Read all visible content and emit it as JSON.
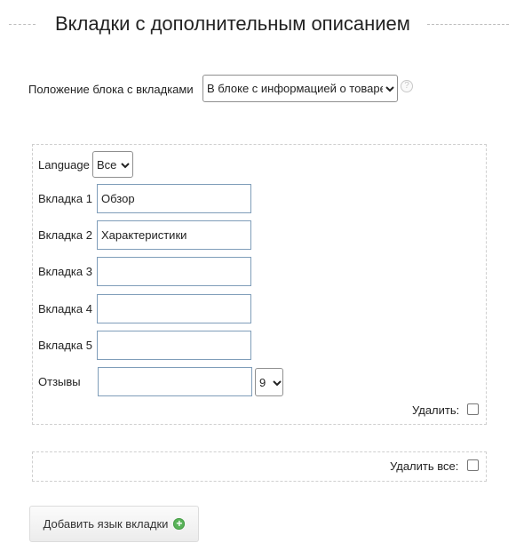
{
  "section": {
    "title": "Вкладки с дополнительным описанием"
  },
  "position": {
    "label": "Положение блока с вкладками",
    "selected": "В блоке с информацией о товаре"
  },
  "tabs_panel": {
    "language_label": "Language",
    "language_selected": "Все",
    "tabs": [
      {
        "label": "Вкладка 1",
        "value": "Обзор"
      },
      {
        "label": "Вкладка 2",
        "value": "Характеристики"
      },
      {
        "label": "Вкладка 3",
        "value": ""
      },
      {
        "label": "Вкладка 4",
        "value": ""
      },
      {
        "label": "Вкладка 5",
        "value": ""
      }
    ],
    "reviews_label": "Отзывы",
    "reviews_value": "",
    "reviews_order": "9",
    "delete_label": "Удалить:"
  },
  "delete_all": {
    "label": "Удалить все:"
  },
  "add_button": {
    "label": "Добавить язык вкладки",
    "icon": "plus-circle-icon"
  }
}
